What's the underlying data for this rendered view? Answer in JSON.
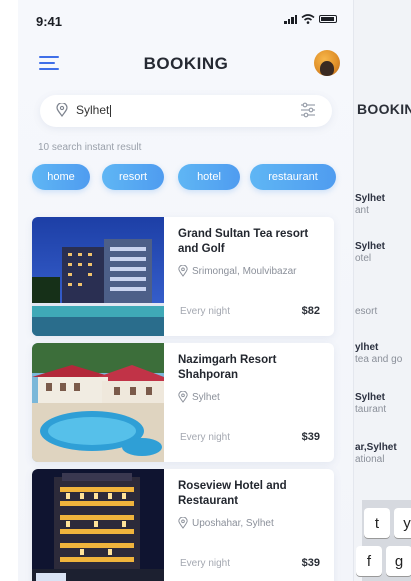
{
  "status_bar": {
    "time": "9:41"
  },
  "header": {
    "title": "BOOKING",
    "menu_icon": "hamburger-menu-icon",
    "avatar_icon": "user-avatar"
  },
  "search": {
    "value": "Sylhet",
    "location_icon": "map-pin-icon",
    "filter_icon": "filter-sliders-icon"
  },
  "result_count_text": "10 search instant result",
  "chips": [
    {
      "label": "home"
    },
    {
      "label": "resort"
    },
    {
      "label": "hotel"
    },
    {
      "label": "restaurant"
    }
  ],
  "listings": [
    {
      "name": "Grand Sultan Tea resort and Golf",
      "location": "Srimongal, Moulvibazar",
      "period": "Every night",
      "price": "$82"
    },
    {
      "name": "Nazimgarh Resort Shahporan",
      "location": "Sylhet",
      "period": "Every night",
      "price": "$39"
    },
    {
      "name": "Roseview Hotel and Restaurant",
      "location": "Uposhahar, Sylhet",
      "period": "Every night",
      "price": "$39"
    }
  ],
  "background_screen": {
    "title": "BOOKIN",
    "rows": [
      {
        "bold": "Sylhet",
        "sub": "ant"
      },
      {
        "bold": "Sylhet",
        "sub": "otel"
      },
      {
        "bold": "",
        "sub": "esort"
      },
      {
        "bold": "ylhet",
        "sub": "tea and go"
      },
      {
        "bold": "Sylhet",
        "sub": "taurant"
      },
      {
        "bold": "ar,Sylhet",
        "sub": "ational"
      }
    ],
    "keys": [
      "t",
      "y",
      "f",
      "g"
    ]
  },
  "colors": {
    "accent": "#3f6fe8",
    "chip_start": "#5fb6f4",
    "chip_end": "#4f9cf0"
  }
}
